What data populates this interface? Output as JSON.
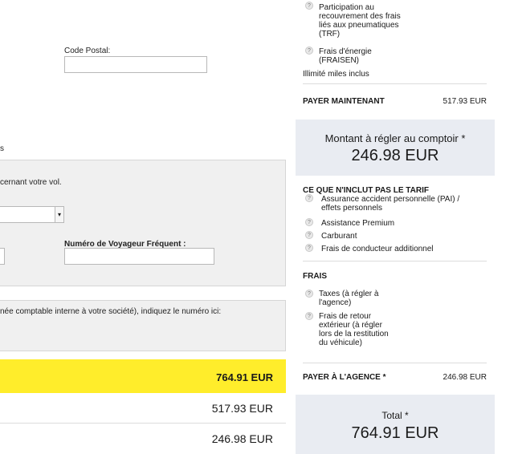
{
  "form": {
    "postal_label": "Code Postal:",
    "section_cut": "s",
    "flight_text": "cernant votre vol.",
    "ff_label": "Numéro de Voyageur Fréquent :",
    "accounting_text": "née comptable interne à votre société), indiquez le numéro ici:",
    "select_arrow": "▾"
  },
  "summary": {
    "total": "764.91 EUR",
    "pay_now": "517.93 EUR",
    "pay_counter": "246.98 EUR"
  },
  "right": {
    "top_items": [
      {
        "text_lines": [
          "Participation au",
          "recouvrement des frais",
          "liés aux pneumatiques",
          "(TRF)"
        ]
      },
      {
        "text_lines": [
          "Frais d'énergie",
          "(FRAISEN)"
        ]
      }
    ],
    "unlimited": "Illimité miles inclus",
    "pay_now_label": "PAYER MAINTENANT",
    "pay_now_value": "517.93 EUR",
    "counter_title": "Montant à régler au comptoir *",
    "counter_amount": "246.98 EUR",
    "not_included_title": "CE QUE N'INCLUT PAS LE TARIF",
    "not_included": [
      {
        "lines": [
          "Assurance accident personnelle (PAI) /",
          "effets personnels"
        ]
      },
      {
        "lines": [
          "Assistance Premium"
        ]
      },
      {
        "lines": [
          "Carburant"
        ]
      },
      {
        "lines": [
          "Frais de conducteur additionnel"
        ]
      }
    ],
    "fees_title": "FRAIS",
    "fees": [
      {
        "lines": [
          "Taxes (à régler à",
          "l'agence)"
        ]
      },
      {
        "lines": [
          "Frais de retour",
          "extérieur (à régler",
          "lors de la restitution",
          "du véhicule)"
        ]
      }
    ],
    "pay_agency_label": "PAYER À L'AGENCE *",
    "pay_agency_value": "246.98 EUR",
    "total_label": "Total *",
    "total_amount": "764.91 EUR",
    "help_glyph": "?"
  },
  "colors": {
    "highlight": "#ffed2b",
    "panel_blue": "#e9ecf2"
  }
}
